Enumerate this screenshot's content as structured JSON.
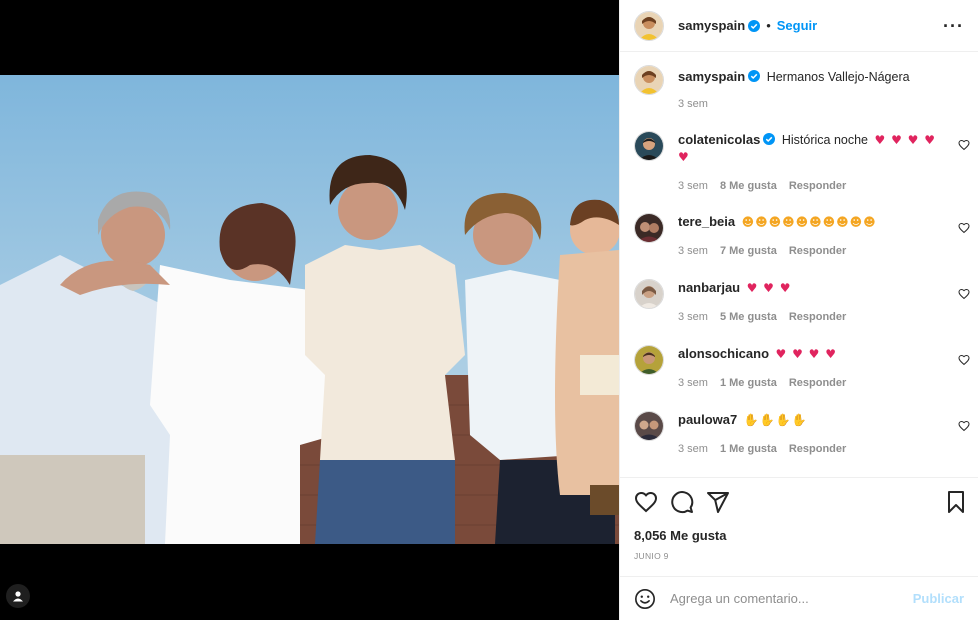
{
  "post": {
    "author": "samyspain",
    "follow_label": "Seguir",
    "caption": "Hermanos Vallejo-Nágera",
    "caption_age": "3 sem",
    "likes": "8,056 Me gusta",
    "date": "JUNIO 9"
  },
  "reply_label": "Responder",
  "comments": [
    {
      "user": "colatenicolas",
      "verified": true,
      "text": "Histórica noche",
      "emoji": "♥ ♥ ♥ ♥ ♥",
      "age": "3 sem",
      "likes": "8 Me gusta"
    },
    {
      "user": "tere_beia",
      "verified": false,
      "text": "",
      "emoji": "☻☻☻☻☻☻☻☻☻☻",
      "age": "3 sem",
      "likes": "7 Me gusta"
    },
    {
      "user": "nanbarjau",
      "verified": false,
      "text": "",
      "emoji": "♥ ♥ ♥",
      "age": "3 sem",
      "likes": "5 Me gusta"
    },
    {
      "user": "alonsochicano",
      "verified": false,
      "text": "",
      "emoji": "♥ ♥ ♥ ♥",
      "age": "3 sem",
      "likes": "1 Me gusta"
    },
    {
      "user": "paulowa7",
      "verified": false,
      "text": "",
      "emoji": "✋✋✋✋",
      "age": "3 sem",
      "likes": "1 Me gusta"
    }
  ],
  "composer": {
    "placeholder": "Agrega un comentario...",
    "publish_label": "Publicar"
  },
  "icons": [
    "verified-icon",
    "more-icon",
    "heart-icon",
    "comment-icon",
    "share-icon",
    "bookmark-icon",
    "emoji-icon",
    "user-tag-icon"
  ],
  "colors": {
    "accent": "#0095f6",
    "publish_disabled": "#b2dffc",
    "muted": "#8e8e8e"
  }
}
